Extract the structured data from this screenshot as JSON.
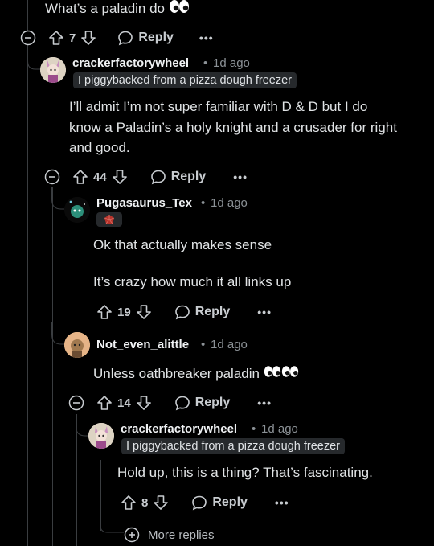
{
  "top": {
    "text": "What’s a paladin do"
  },
  "c1": {
    "votes": "7",
    "reply": "Reply",
    "more": "•••"
  },
  "c2": {
    "author": "crackerfactorywheel",
    "time": "1d ago",
    "flair": "I piggybacked from a pizza dough freezer",
    "body": "I’ll admit I’m not super familiar with D & D but I do know a Paladin’s a holy knight and a crusader for right and good.",
    "votes": "44",
    "reply": "Reply",
    "more": "•••"
  },
  "c3": {
    "author": "Pugasaurus_Tex",
    "time": "1d ago",
    "body1": "Ok that actually makes sense",
    "body2": "It’s crazy how much it all links up",
    "votes": "19",
    "reply": "Reply",
    "more": "•••"
  },
  "c4": {
    "author": "Not_even_alittle",
    "time": "1d ago",
    "body": "Unless oathbreaker paladin",
    "votes": "14",
    "reply": "Reply",
    "more": "•••"
  },
  "c5": {
    "author": "crackerfactorywheel",
    "time": "1d ago",
    "flair": "I piggybacked from a pizza dough freezer",
    "body": "Hold up, this is a thing? That’s fascinating.",
    "votes": "8",
    "reply": "Reply",
    "more": "•••"
  },
  "more_replies": "More replies",
  "separator": "•"
}
